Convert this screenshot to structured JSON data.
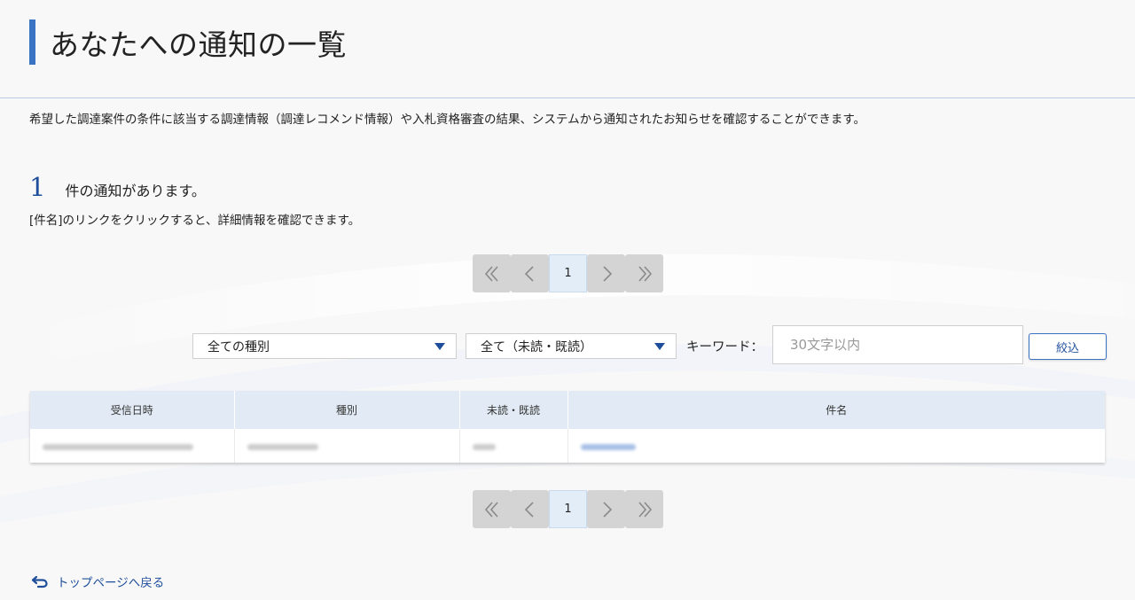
{
  "page": {
    "title": "あなたへの通知の一覧",
    "description": "希望した調達案件の条件に該当する調達情報（調達レコメンド情報）や入札資格審査の結果、システムから通知されたお知らせを確認することができます。"
  },
  "summary": {
    "count": "1",
    "count_suffix": "件の通知があります。",
    "hint": "[件名]のリンクをクリックすると、詳細情報を確認できます。"
  },
  "pagination": {
    "current_page": "1",
    "icons": [
      "double-chevron-left-icon",
      "chevron-left-icon",
      "chevron-right-icon",
      "double-chevron-right-icon"
    ]
  },
  "filters": {
    "type_selected": "全ての種別",
    "read_selected": "全て（未読・既読）",
    "keyword_label": "キーワード：",
    "keyword_placeholder": "30文字以内",
    "keyword_value": "",
    "submit_label": "絞込"
  },
  "table": {
    "headers": [
      "受信日時",
      "種別",
      "未読・既読",
      "件名"
    ],
    "rows": [
      {
        "received": "",
        "type": "",
        "status": "",
        "subject": "",
        "blurred": true
      }
    ]
  },
  "footer": {
    "back_label": "トップページへ戻る"
  },
  "colors": {
    "accent": "#3a72c4",
    "link": "#1f4f9b",
    "header_bg": "#e2ebf5",
    "pager_btn": "#d4d4d4"
  }
}
